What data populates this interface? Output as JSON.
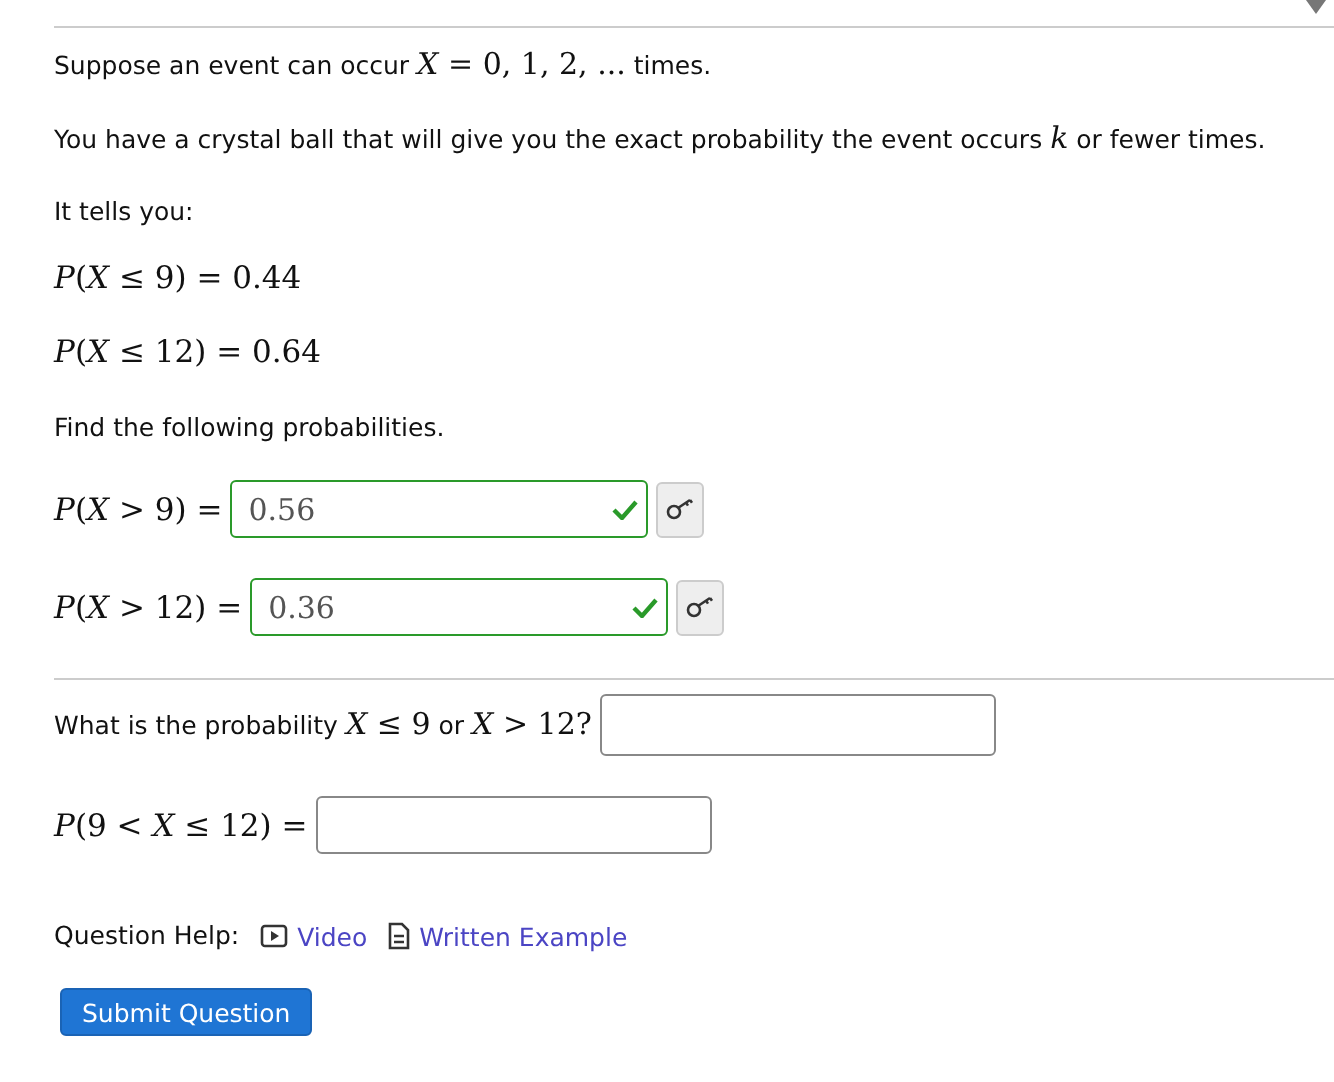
{
  "intro": [
    {
      "kind": "text",
      "s": "Suppose an event can occur "
    },
    {
      "kind": "math",
      "s": "*X* = 0, 1, 2, ..."
    },
    {
      "kind": "text",
      "s": " times."
    }
  ],
  "crystal": [
    {
      "kind": "text",
      "s": "You have a crystal ball that will give you the exact probability the event occurs "
    },
    {
      "kind": "math",
      "s": "*k*"
    },
    {
      "kind": "text",
      "s": " or fewer times."
    }
  ],
  "tells": "It tells you:",
  "givens": [
    "*P*(*X* ≤ 9) = 0.44",
    "*P*(*X* ≤ 12) = 0.64"
  ],
  "find": "Find the following probabilities.",
  "answers": [
    {
      "label": "*P*(*X* > 9) =",
      "value": "0.56",
      "correct": true
    },
    {
      "label": "*P*(*X* > 12) =",
      "value": "0.36",
      "correct": true
    }
  ],
  "question": [
    {
      "kind": "text",
      "s": "What is the probability "
    },
    {
      "kind": "math",
      "s": "*X* ≤ 9"
    },
    {
      "kind": "text",
      "s": " or "
    },
    {
      "kind": "math",
      "s": "*X* > 12?"
    }
  ],
  "between": {
    "label": "*P*(9 < *X* ≤ 12) ="
  },
  "help": {
    "label": "Question Help:",
    "links": [
      {
        "kind": "video",
        "text": "Video"
      },
      {
        "kind": "document",
        "text": "Written Example"
      }
    ]
  },
  "submit": "Submit Question"
}
